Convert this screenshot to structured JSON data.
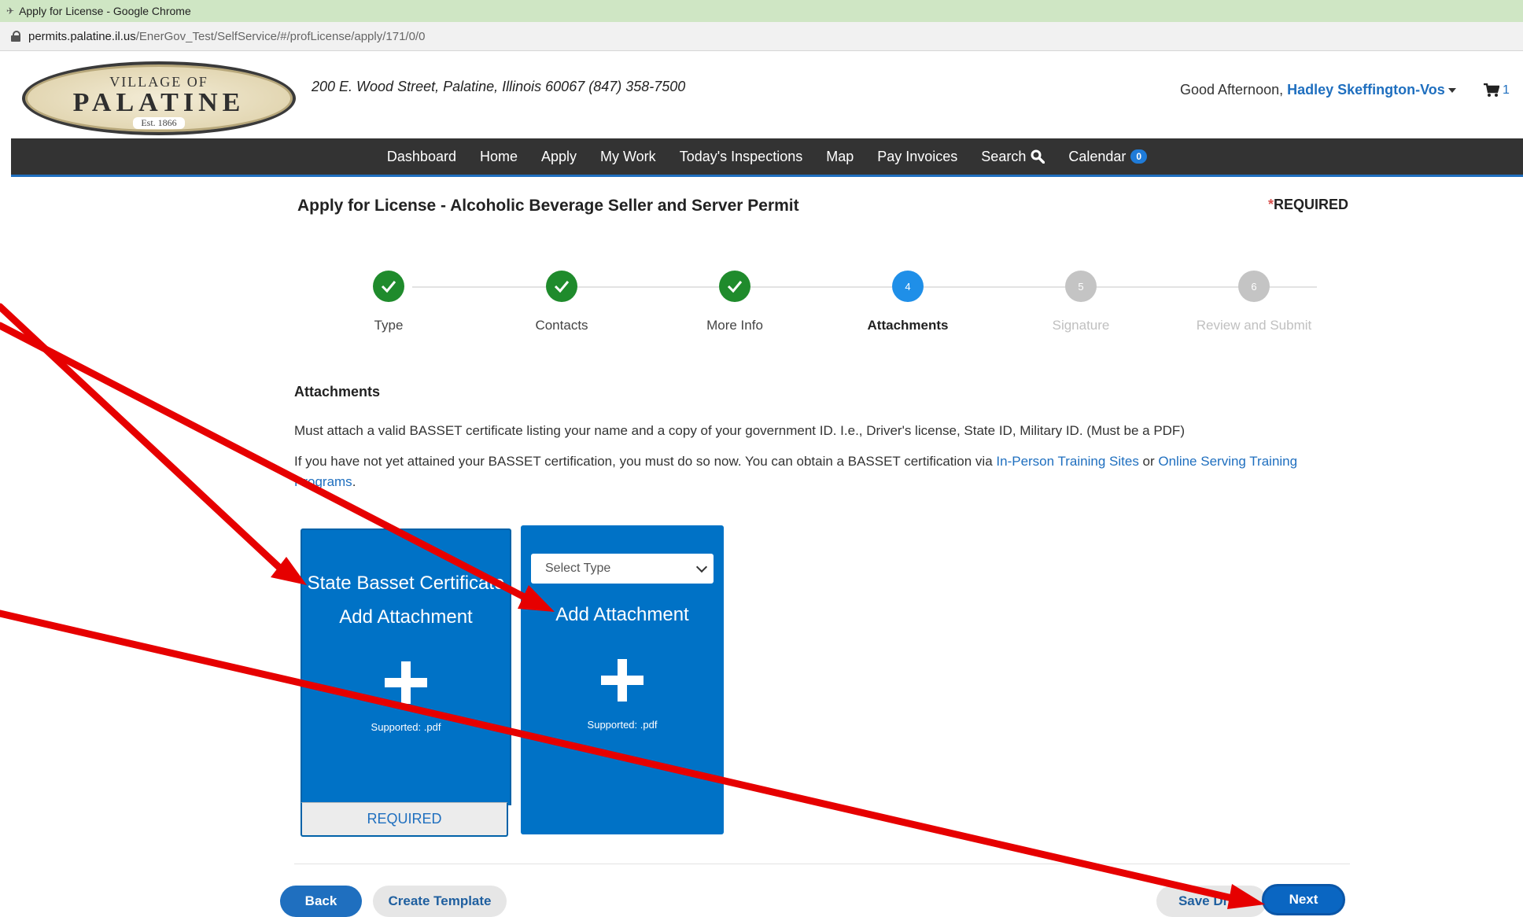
{
  "browser": {
    "window_title": "Apply for License - Google Chrome",
    "url_host": "permits.palatine.il.us",
    "url_path": "/EnerGov_Test/SelfService/#/profLicense/apply/171/0/0"
  },
  "header": {
    "logo_line1": "VILLAGE OF",
    "logo_line2": "PALATINE",
    "logo_line3": "Est. 1866",
    "address": "200 E. Wood Street, Palatine, Illinois 60067  (847) 358-7500",
    "greeting_prefix": "Good Afternoon,",
    "user_name": "Hadley Skeffington-Vos",
    "cart_count": "1"
  },
  "nav": {
    "items": [
      "Dashboard",
      "Home",
      "Apply",
      "My Work",
      "Today's Inspections",
      "Map",
      "Pay Invoices",
      "Search",
      "Calendar"
    ],
    "calendar_badge": "0"
  },
  "page": {
    "title": "Apply for License - Alcoholic Beverage Seller and Server Permit",
    "required_star": "*",
    "required_label": "REQUIRED"
  },
  "stepper": {
    "steps": [
      {
        "number": "1",
        "label": "Type",
        "state": "done"
      },
      {
        "number": "2",
        "label": "Contacts",
        "state": "done"
      },
      {
        "number": "3",
        "label": "More Info",
        "state": "done"
      },
      {
        "number": "4",
        "label": "Attachments",
        "state": "active"
      },
      {
        "number": "5",
        "label": "Signature",
        "state": "future"
      },
      {
        "number": "6",
        "label": "Review and Submit",
        "state": "future"
      }
    ]
  },
  "attachments": {
    "section_title": "Attachments",
    "instruction1": "Must attach a valid BASSET certificate listing your name and a copy of your government ID. I.e., Driver's license, State ID, Military ID. (Must be a PDF)",
    "instruction2_prefix": "If you have not yet attained your BASSET certification, you must do so now. You can obtain a BASSET certification via ",
    "link1": "In-Person Training Sites",
    "instruction2_mid": " or ",
    "link2": "Online Serving Training Programs",
    "instruction2_suffix": ".",
    "card1": {
      "title": "State Basset Certificate",
      "action": "Add Attachment",
      "supported": "Supported: .pdf",
      "footer": "REQUIRED"
    },
    "card2": {
      "select_placeholder": "Select Type",
      "action": "Add Attachment",
      "supported": "Supported: .pdf"
    }
  },
  "footer_buttons": {
    "back": "Back",
    "create_template": "Create Template",
    "save_draft": "Save Draft",
    "next": "Next"
  },
  "colors": {
    "primary_blue": "#0072c6",
    "link_blue": "#1f6fbf",
    "step_done": "#1f8b2c",
    "step_active": "#1f8fe8",
    "nav_bg": "#333333",
    "annotation_red": "#e60000"
  }
}
